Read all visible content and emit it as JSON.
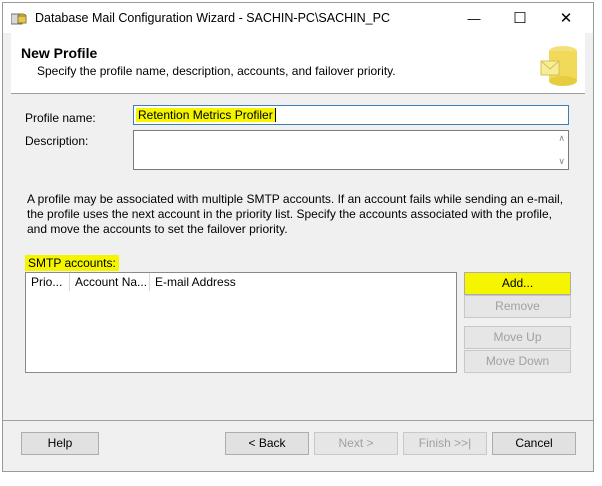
{
  "window": {
    "title": "Database Mail Configuration Wizard - SACHIN-PC\\SACHIN_PC",
    "minimize_glyph": "—",
    "maximize_glyph": "☐",
    "close_glyph": "✕"
  },
  "header": {
    "title": "New Profile",
    "subtitle": "Specify the profile name, description, accounts, and failover priority."
  },
  "form": {
    "profile_name_label": "Profile name:",
    "profile_name_value": "Retention Metrics Profiler",
    "description_label": "Description:",
    "description_value": ""
  },
  "info_text": "A profile may be associated with multiple SMTP accounts. If an account fails while sending an e-mail, the profile uses the next account in the priority list. Specify the accounts associated with the profile, and move the accounts to set the failover priority.",
  "smtp": {
    "label": "SMTP accounts:",
    "columns": [
      "Prio...",
      "Account Na...",
      "E-mail Address"
    ],
    "rows": [],
    "buttons": {
      "add": "Add...",
      "remove": "Remove",
      "move_up": "Move Up",
      "move_down": "Move Down"
    }
  },
  "footer": {
    "help": "Help",
    "back": "< Back",
    "next": "Next >",
    "finish": "Finish >>|",
    "cancel": "Cancel"
  },
  "colors": {
    "highlight": "#f5f500",
    "focus_border": "#3c7fb1"
  }
}
